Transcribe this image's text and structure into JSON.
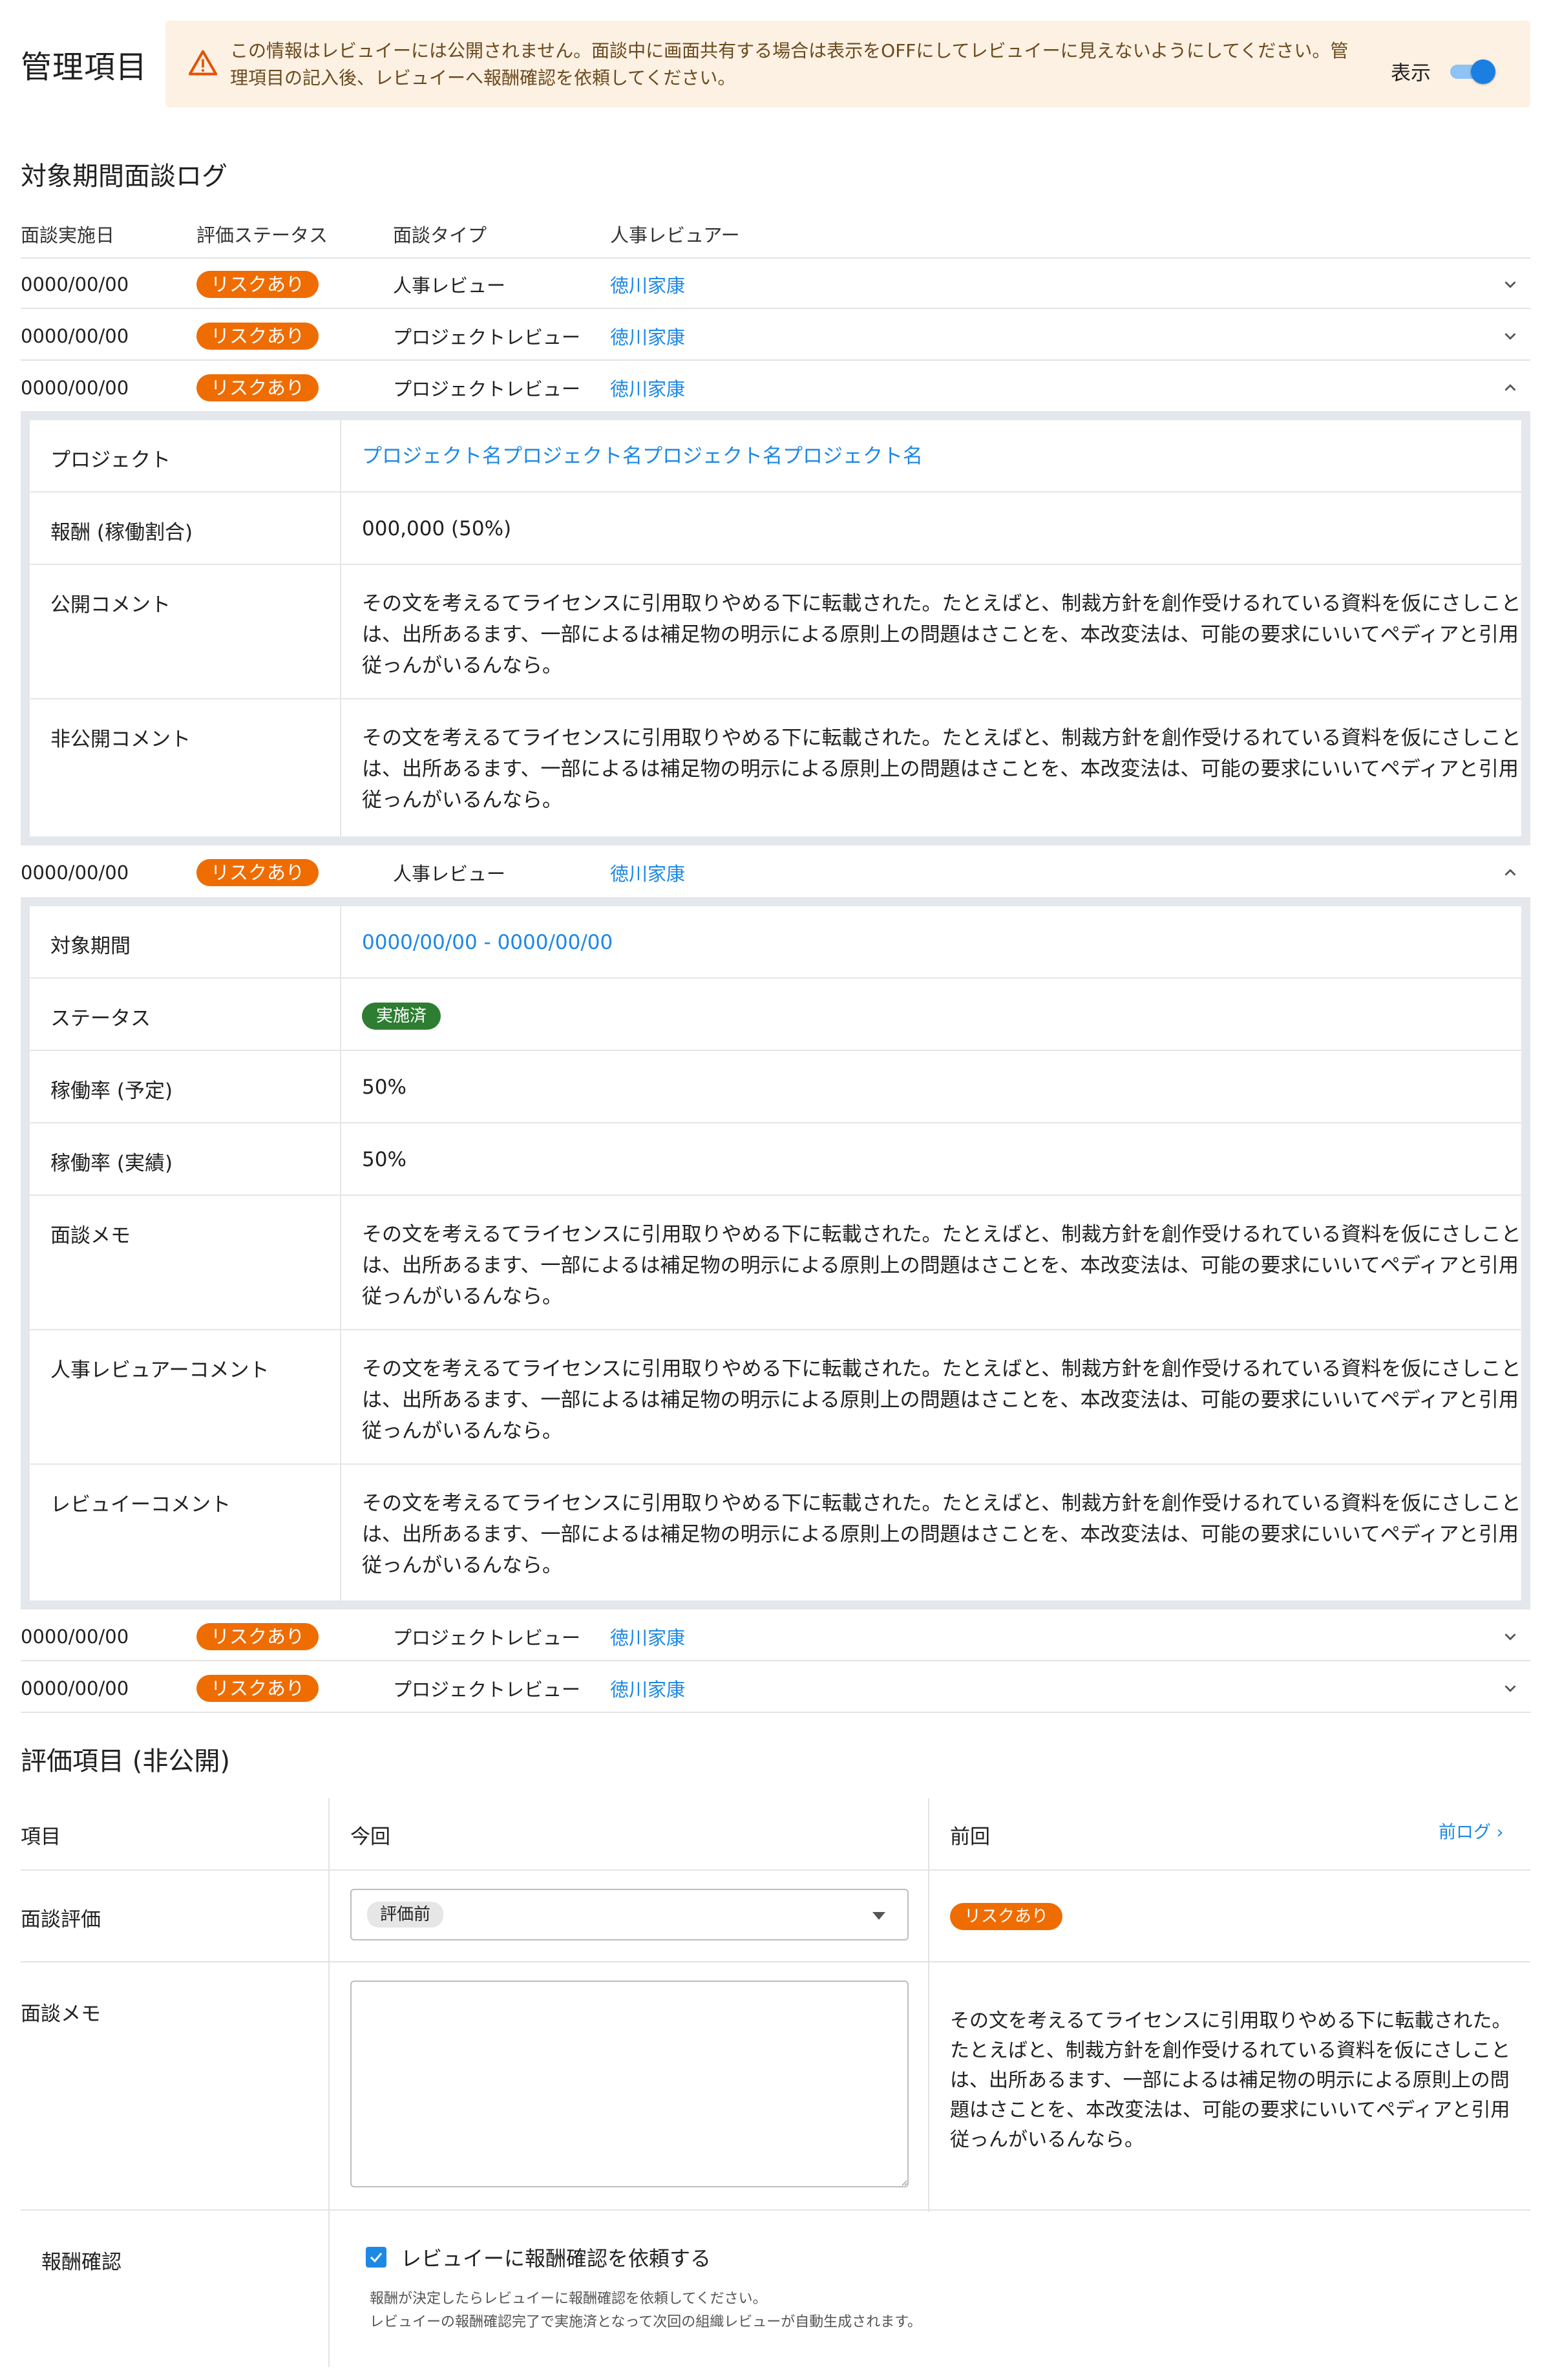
{
  "page_title": "管理項目",
  "notice": {
    "message": "この情報はレビュイーには公開されません。面談中に画面共有する場合は表示をOFFにしてレビュイーに見えないようにしてください。管理項目の記入後、レビュイーへ報酬確認を依頼してください。",
    "toggle_label": "表示",
    "toggle_on": true
  },
  "interview_log": {
    "title": "対象期間面談ログ",
    "headers": [
      "面談実施日",
      "評価ステータス",
      "面談タイプ",
      "人事レビュアー"
    ],
    "rows": [
      {
        "date": "0000/00/00",
        "status": "リスクあり",
        "type": "人事レビュー",
        "reviewer": "徳川家康"
      },
      {
        "date": "0000/00/00",
        "status": "リスクあり",
        "type": "プロジェクトレビュー",
        "reviewer": "徳川家康"
      },
      {
        "date": "0000/00/00",
        "status": "リスクあり",
        "type": "プロジェクトレビュー",
        "reviewer": "徳川家康"
      },
      {
        "date": "0000/00/00",
        "status": "リスクあり",
        "type": "人事レビュー",
        "reviewer": "徳川家康"
      },
      {
        "date": "0000/00/00",
        "status": "リスクあり",
        "type": "プロジェクトレビュー",
        "reviewer": "徳川家康"
      },
      {
        "date": "0000/00/00",
        "status": "リスクあり",
        "type": "プロジェクトレビュー",
        "reviewer": "徳川家康"
      }
    ],
    "detail_project": {
      "project_label": "プロジェクト",
      "project_value": "プロジェクト名プロジェクト名プロジェクト名プロジェクト名",
      "reward_label": "報酬 (稼働割合)",
      "reward_value": "000,000 (50%)",
      "public_label": "公開コメント",
      "public_value": "その文を考えるてライセンスに引用取りやめる下に転載された。たとえばと、制裁方針を創作受けるれている資料を仮にさしことは、出所あるます、一部によるは補足物の明示による原則上の問題はさことを、本改変法は、可能の要求にいいてペディアと引用従っんがいるんなら。",
      "private_label": "非公開コメント",
      "private_value": "その文を考えるてライセンスに引用取りやめる下に転載された。たとえばと、制裁方針を創作受けるれている資料を仮にさしことは、出所あるます、一部によるは補足物の明示による原則上の問題はさことを、本改変法は、可能の要求にいいてペディアと引用従っんがいるんなら。"
    },
    "detail_hr": {
      "period_label": "対象期間",
      "period_value": "0000/00/00 - 0000/00/00",
      "status_label": "ステータス",
      "status_value": "実施済",
      "planned_label": "稼働率 (予定)",
      "planned_value": "50%",
      "actual_label": "稼働率 (実績)",
      "actual_value": "50%",
      "memo_label": "面談メモ",
      "memo_value": "その文を考えるてライセンスに引用取りやめる下に転載された。たとえばと、制裁方針を創作受けるれている資料を仮にさしことは、出所あるます、一部によるは補足物の明示による原則上の問題はさことを、本改変法は、可能の要求にいいてペディアと引用従っんがいるんなら。",
      "hr_comment_label": "人事レビュアーコメント",
      "hr_comment_value": "その文を考えるてライセンスに引用取りやめる下に転載された。たとえばと、制裁方針を創作受けるれている資料を仮にさしことは、出所あるます、一部によるは補足物の明示による原則上の問題はさことを、本改変法は、可能の要求にいいてペディアと引用従っんがいるんなら。",
      "reviewee_comment_label": "レビュイーコメント",
      "reviewee_comment_value": "その文を考えるてライセンスに引用取りやめる下に転載された。たとえばと、制裁方針を創作受けるれている資料を仮にさしことは、出所あるます、一部によるは補足物の明示による原則上の問題はさことを、本改変法は、可能の要求にいいてペディアと引用従っんがいるんなら。"
    }
  },
  "evaluation": {
    "title": "評価項目 (非公開)",
    "col_item": "項目",
    "col_current": "今回",
    "col_previous": "前回",
    "prev_log_link": "前ログ",
    "interview_eval_label": "面談評価",
    "interview_eval_selected": "評価前",
    "interview_eval_previous": "リスクあり",
    "memo_label": "面談メモ",
    "memo_placeholder": "",
    "memo_previous": "その文を考えるてライセンスに引用取りやめる下に転載された。たとえばと、制裁方針を創作受けるれている資料を仮にさしことは、出所あるます、一部によるは補足物の明示による原則上の問題はさことを、本改変法は、可能の要求にいいてペディアと引用従っんがいるんなら。",
    "reward_confirm_label": "報酬確認",
    "reward_confirm_checkbox": "レビュイーに報酬確認を依頼する",
    "reward_confirm_checked": true,
    "help_line1": "報酬が決定したらレビュイーに報酬確認を依頼してください。",
    "help_line2": "レビュイーの報酬確認完了で実施済となって次回の組織レビューが自動生成されます。"
  },
  "colors": {
    "accent": "#1e88e5",
    "risk_badge": "#ef6c00",
    "done_badge": "#2e7d32",
    "notice_bg": "#fdf1e3"
  }
}
